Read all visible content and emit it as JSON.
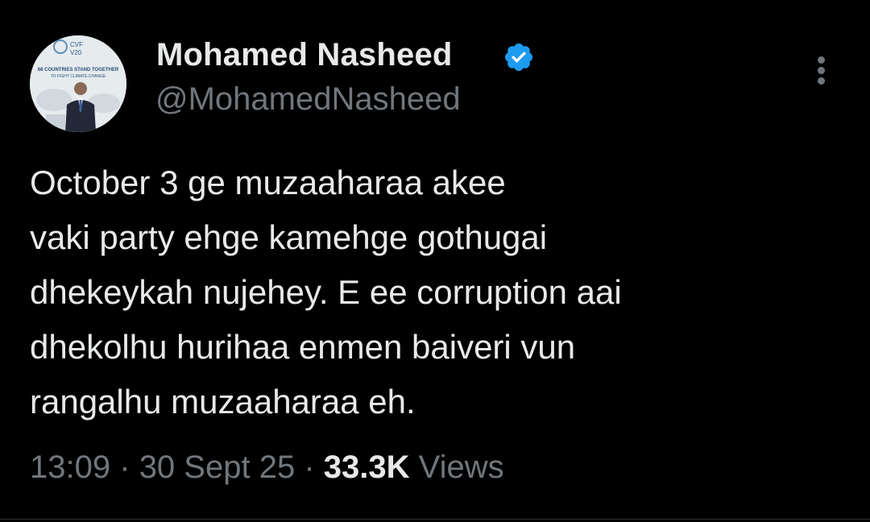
{
  "author": {
    "display_name": "Mohamed Nasheed",
    "handle": "@MohamedNasheed",
    "verified": true,
    "avatar": {
      "banner_lines": [
        "68 COUNTRIES STAND TOGETHER",
        "TO FIGHT CLIMATE CHANGE"
      ],
      "logo_text": [
        "CVF",
        "V20"
      ]
    }
  },
  "tweet": {
    "lines": [
      "October 3 ge muzaaharaa akee",
      "vaki party ehge kamehge gothugai",
      "dhekeykah nujehey. E ee corruption aai",
      "dhekolhu hurihaa enmen baiveri vun",
      "rangalhu muzaaharaa eh."
    ]
  },
  "meta": {
    "time": "13:09",
    "separator": "·",
    "date": "30 Sept 25",
    "views_count": "33.3K",
    "views_label": "Views"
  },
  "colors": {
    "background": "#000000",
    "text_primary": "#e7e9ea",
    "text_secondary": "#71767b",
    "verified_blue": "#1d9bf0"
  },
  "icons": {
    "verified": "verified-badge-icon",
    "more": "more-vertical-icon"
  }
}
